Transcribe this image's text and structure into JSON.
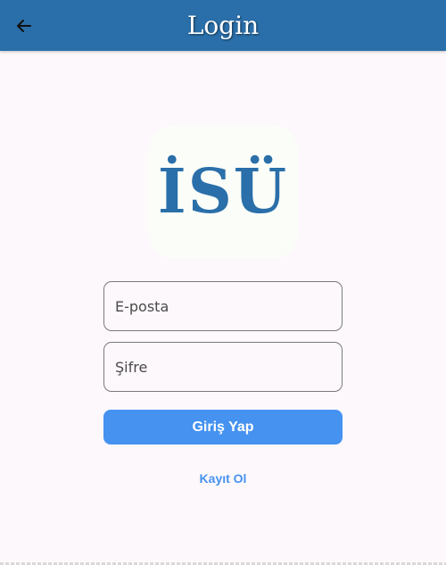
{
  "app_bar": {
    "title": "Login",
    "back_icon": "arrow-left-icon",
    "background_color": "#2a6fa9"
  },
  "logo": {
    "text": "İSÜ",
    "color": "#2a6fa9"
  },
  "form": {
    "email_placeholder": "E-posta",
    "email_value": "",
    "password_placeholder": "Şifre",
    "password_value": "",
    "login_button_label": "Giriş Yap",
    "register_link_label": "Kayıt Ol"
  },
  "colors": {
    "accent": "#4592f0",
    "background": "#fdf8fc",
    "field_border": "#7a7a7a"
  }
}
